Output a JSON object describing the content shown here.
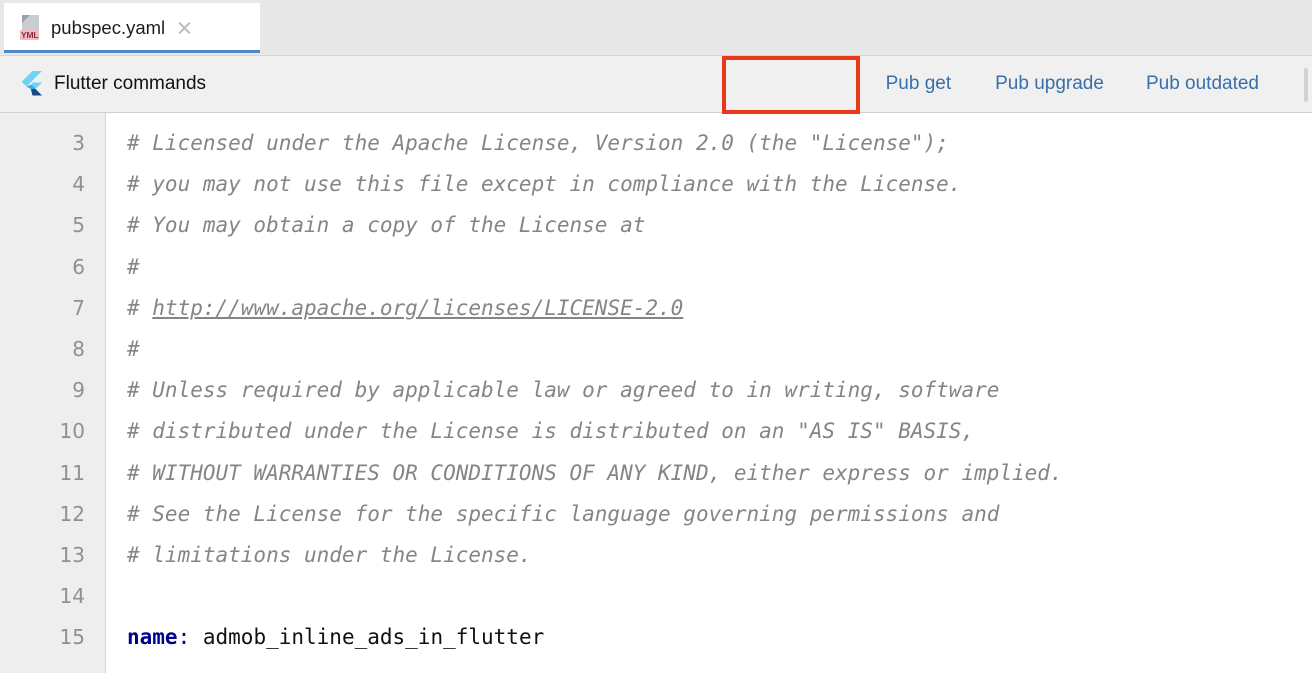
{
  "tab": {
    "filename": "pubspec.yaml",
    "icon_name": "yml-file-icon",
    "badge": "YML",
    "close_label": "×"
  },
  "toolbar": {
    "title": "Flutter commands",
    "logo_name": "flutter-logo-icon",
    "actions": [
      {
        "label": "Pub get",
        "highlighted": true
      },
      {
        "label": "Pub upgrade",
        "highlighted": false
      },
      {
        "label": "Pub outdated",
        "highlighted": false
      }
    ],
    "highlight_color": "#e8371a",
    "link_color": "#3a6fa8"
  },
  "editor": {
    "first_line_number": 3,
    "lines": [
      {
        "num": "3",
        "type": "comment",
        "text": "# Licensed under the Apache License, Version 2.0 (the \"License\");"
      },
      {
        "num": "4",
        "type": "comment",
        "text": "# you may not use this file except in compliance with the License."
      },
      {
        "num": "5",
        "type": "comment",
        "text": "# You may obtain a copy of the License at"
      },
      {
        "num": "6",
        "type": "comment",
        "text": "#"
      },
      {
        "num": "7",
        "type": "comment-link",
        "prefix": "# ",
        "link": "http://www.apache.org/licenses/LICENSE-2.0"
      },
      {
        "num": "8",
        "type": "comment",
        "text": "#"
      },
      {
        "num": "9",
        "type": "comment",
        "text": "# Unless required by applicable law or agreed to in writing, software"
      },
      {
        "num": "10",
        "type": "comment",
        "text": "# distributed under the License is distributed on an \"AS IS\" BASIS,"
      },
      {
        "num": "11",
        "type": "comment",
        "text": "# WITHOUT WARRANTIES OR CONDITIONS OF ANY KIND, either express or implied."
      },
      {
        "num": "12",
        "type": "comment",
        "text": "# See the License for the specific language governing permissions and"
      },
      {
        "num": "13",
        "type": "comment",
        "text": "# limitations under the License."
      },
      {
        "num": "14",
        "type": "blank",
        "text": ""
      },
      {
        "num": "15",
        "type": "keyvalue",
        "key": "name",
        "punct": ":",
        "value": " admob_inline_ads_in_flutter"
      }
    ]
  }
}
